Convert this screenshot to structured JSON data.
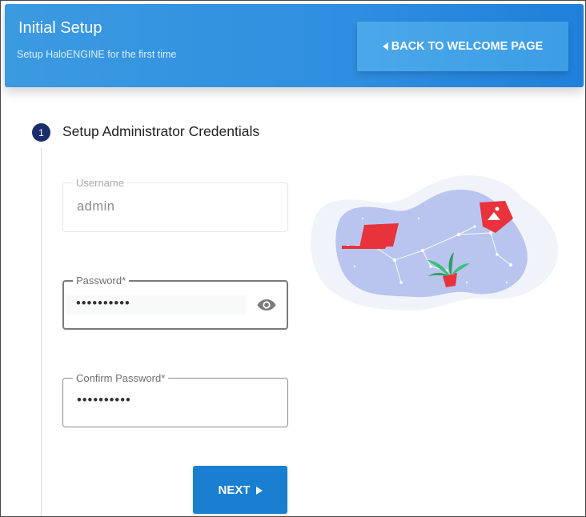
{
  "header": {
    "title": "Initial Setup",
    "subtitle": "Setup HaloENGINE for the first time",
    "back_button": "BACK TO WELCOME PAGE",
    "back_icon": "triangle-left-icon"
  },
  "step": {
    "number": "1",
    "title": "Setup Administrator Credentials"
  },
  "form": {
    "username": {
      "label": "Username",
      "value": "admin"
    },
    "password": {
      "label": "Password*",
      "value": "••••••••••",
      "icon": "eye-icon"
    },
    "confirm_password": {
      "label": "Confirm Password*",
      "value": "••••••••••"
    }
  },
  "next_button": {
    "label": "NEXT",
    "icon": "arrow-right-icon"
  },
  "colors": {
    "header": "#2f8ee0",
    "primary_button": "#1a7fd0",
    "step_dot": "#1a2e6b",
    "illustration_blob": "#b8c6f0",
    "accent_red": "#e8323c"
  }
}
